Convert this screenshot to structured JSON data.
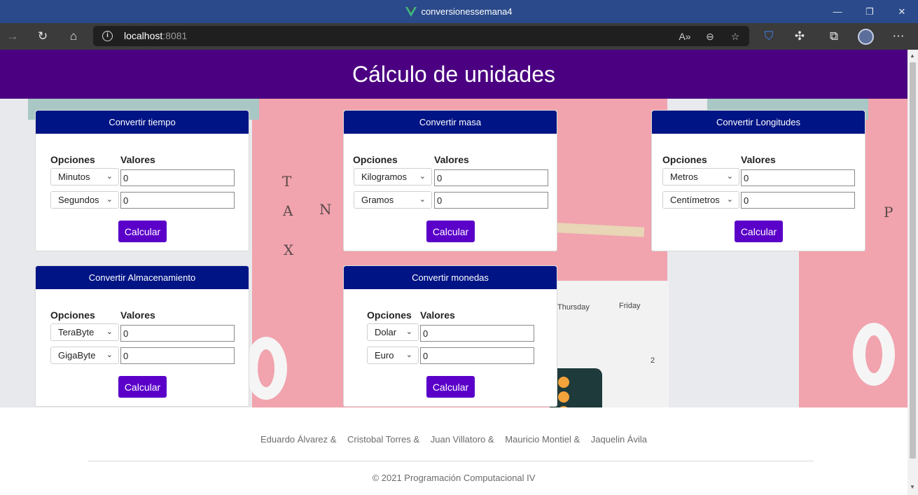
{
  "browser": {
    "window_title": "conversionessemana4",
    "url_host": "localhost",
    "url_port": ":8081",
    "colors": {
      "titlebar": "#2b4a8b",
      "toolbar": "#3b3b3b",
      "address_bg": "#1f1f1f"
    }
  },
  "page": {
    "header_title": "Cálculo de unidades",
    "colors": {
      "header": "#4b0082",
      "card_header": "#001485",
      "button": "#5a00c8"
    }
  },
  "labels": {
    "options": "Opciones",
    "values": "Valores",
    "calculate": "Calcular"
  },
  "cards": {
    "time": {
      "title": "Convertir tiempo",
      "row1_unit": "Minutos",
      "row1_value": "0",
      "row2_unit": "Segundos",
      "row2_value": "0"
    },
    "mass": {
      "title": "Convertir masa",
      "row1_unit": "Kilogramos",
      "row1_value": "0",
      "row2_unit": "Gramos",
      "row2_value": "0"
    },
    "length": {
      "title": "Convertir Longitudes",
      "row1_unit": "Metros",
      "row1_value": "0",
      "row2_unit": "Centímetros",
      "row2_value": "0"
    },
    "storage": {
      "title": "Convertir Almacenamiento",
      "row1_unit": "TeraByte",
      "row1_value": "0",
      "row2_unit": "GigaByte",
      "row2_value": "0"
    },
    "currency": {
      "title": "Convertir monedas",
      "row1_unit": "Dolar",
      "row1_value": "0",
      "row2_unit": "Euro",
      "row2_value": "0"
    }
  },
  "background_text": {
    "stamp_t": "T",
    "stamp_a": "A",
    "stamp_n": "N",
    "stamp_x": "X",
    "stamp_p": "P",
    "cal_thursday": "Thursday",
    "cal_friday": "Friday",
    "cal_num": "2"
  },
  "footer": {
    "authors": [
      "Eduardo Álvarez &",
      "Cristobal Torres &",
      "Juan Villatoro &",
      "Mauricio Montiel &",
      "Jaquelin Ávila"
    ],
    "copyright": "© 2021 Programación Computacional IV"
  }
}
